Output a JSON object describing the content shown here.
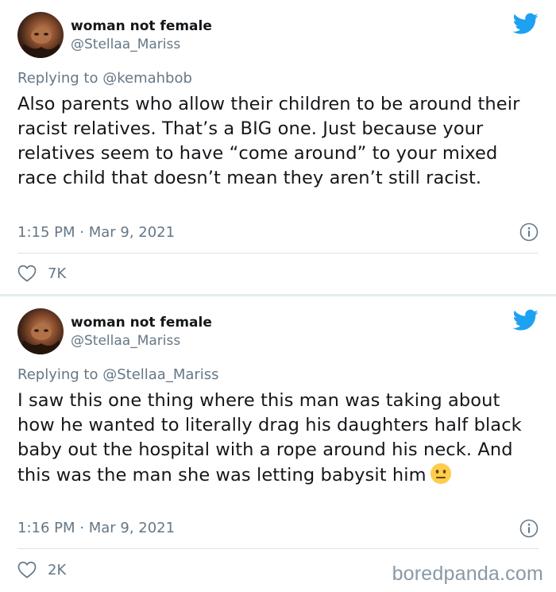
{
  "tweets": [
    {
      "author_name": "woman not female",
      "author_handle": "@Stellaa_Mariss",
      "replying_prefix": "Replying to",
      "replying_to": "@kemahbob",
      "text": "Also parents who allow their children to be around their racist relatives. That’s a BIG one. Just because your relatives seem to have “come around” to your mixed race child that doesn’t mean they aren’t still racist.",
      "timestamp": "1:15 PM · Mar 9, 2021",
      "likes": "7K"
    },
    {
      "author_name": "woman not female",
      "author_handle": "@Stellaa_Mariss",
      "replying_prefix": "Replying to",
      "replying_to": "@Stellaa_Mariss",
      "text": "I saw this one thing where this man was taking about how he wanted to literally drag his daughters half black baby out the hospital with a rope around his neck. And this was the man she was letting babysit him",
      "emoji": "neutral-face-emoji",
      "timestamp": "1:16 PM · Mar 9, 2021",
      "likes": "2K"
    }
  ],
  "watermark": "boredpanda.com",
  "colors": {
    "twitter_blue": "#1da1f2",
    "secondary_text": "#657786",
    "primary_text": "#14171a",
    "background": "#e6ecf0",
    "card": "#ffffff",
    "divider": "#dde3e8"
  },
  "icons": [
    "twitter-bird-icon",
    "info-icon",
    "heart-icon",
    "neutral-face-emoji"
  ]
}
